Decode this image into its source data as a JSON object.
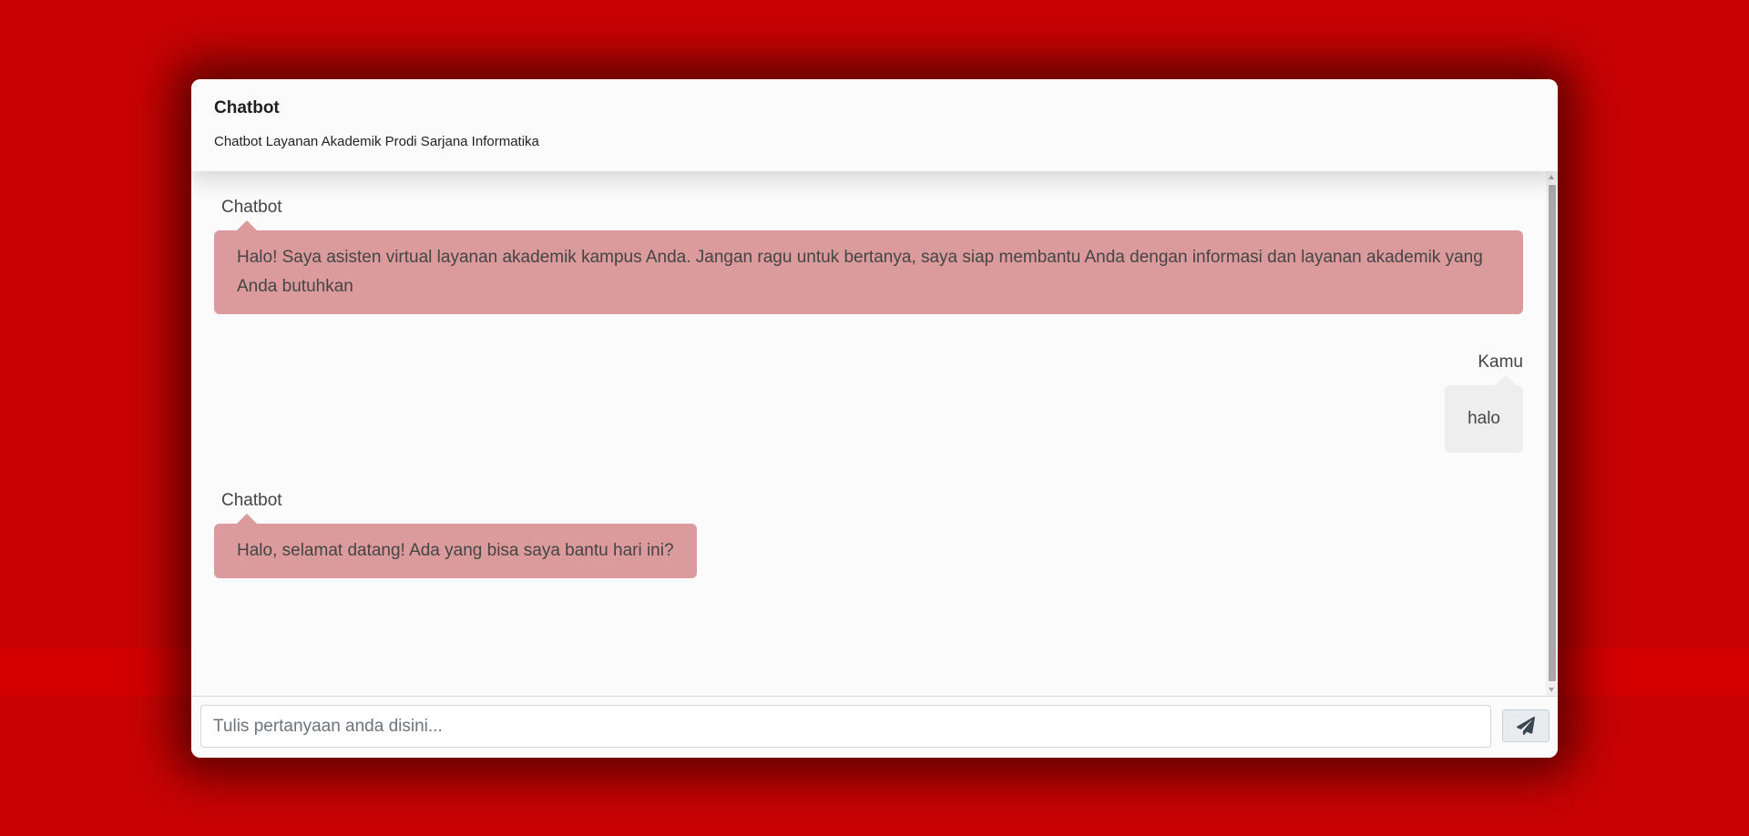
{
  "header": {
    "title": "Chatbot",
    "subtitle": "Chatbot Layanan Akademik Prodi Sarjana Informatika"
  },
  "messages": [
    {
      "sender": "Chatbot",
      "role": "bot",
      "text": "Halo! Saya asisten virtual layanan akademik kampus Anda. Jangan ragu untuk bertanya, saya siap membantu Anda dengan informasi dan layanan akademik yang Anda butuhkan"
    },
    {
      "sender": "Kamu",
      "role": "user",
      "text": "halo"
    },
    {
      "sender": "Chatbot",
      "role": "bot",
      "text": "Halo, selamat datang! Ada yang bisa saya bantu hari ini?"
    }
  ],
  "input": {
    "placeholder": "Tulis pertanyaan anda disini...",
    "value": ""
  },
  "send_button": {
    "icon": "paper-plane-icon"
  },
  "colors": {
    "background": "#c90303",
    "bot_bubble": "#db9a9b",
    "user_bubble": "#eeeeee",
    "card": "#fbfbfb"
  }
}
